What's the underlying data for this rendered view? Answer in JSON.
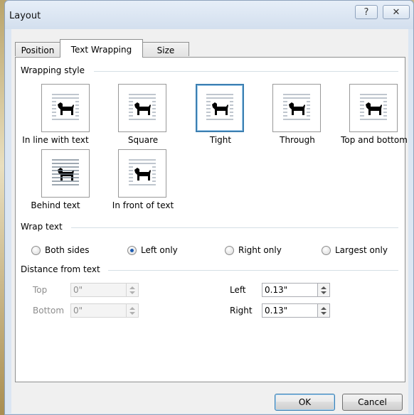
{
  "window": {
    "title": "Layout",
    "help_glyph": "?",
    "close_glyph": "✕"
  },
  "tabs": [
    {
      "label": "Position",
      "active": false
    },
    {
      "label": "Text Wrapping",
      "active": true
    },
    {
      "label": "Size",
      "active": false
    }
  ],
  "wrapping_style": {
    "heading": "Wrapping style",
    "options": [
      {
        "label": "In line with text",
        "accel": "I",
        "icon": "inline-wrap-icon",
        "selected": false
      },
      {
        "label": "Square",
        "accel": "q",
        "icon": "square-wrap-icon",
        "selected": false
      },
      {
        "label": "Tight",
        "accel": "T",
        "icon": "tight-wrap-icon",
        "selected": true
      },
      {
        "label": "Through",
        "accel": "h",
        "icon": "through-wrap-icon",
        "selected": false
      },
      {
        "label": "Top and bottom",
        "accel": "o",
        "icon": "top-bottom-wrap-icon",
        "selected": false
      },
      {
        "label": "Behind text",
        "accel": "B",
        "icon": "behind-text-icon",
        "selected": false
      },
      {
        "label": "In front of text",
        "accel": "f",
        "icon": "in-front-text-icon",
        "selected": false
      }
    ]
  },
  "wrap_text": {
    "heading": "Wrap text",
    "options": [
      {
        "label": "Both sides",
        "accel": "s",
        "checked": false
      },
      {
        "label": "Left only",
        "accel": "L",
        "checked": true
      },
      {
        "label": "Right only",
        "accel": "R",
        "checked": false
      },
      {
        "label": "Largest only",
        "accel": "a",
        "checked": false
      }
    ]
  },
  "distance": {
    "heading": "Distance from text",
    "top": {
      "label": "Top",
      "value": "0\"",
      "enabled": false
    },
    "bottom": {
      "label": "Bottom",
      "value": "0\"",
      "enabled": false
    },
    "left": {
      "label": "Left",
      "value": "0.13\"",
      "enabled": true
    },
    "right": {
      "label": "Right",
      "value": "0.13\"",
      "enabled": true
    }
  },
  "buttons": {
    "ok": "OK",
    "cancel": "Cancel"
  },
  "colors": {
    "selection_border": "#3c7fb1",
    "title_bg": "#dbe6f3"
  }
}
